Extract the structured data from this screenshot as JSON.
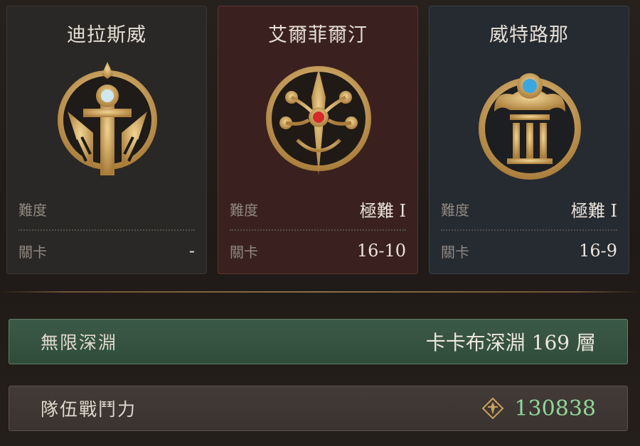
{
  "cards": [
    {
      "title": "迪拉斯威",
      "difficulty_label": "難度",
      "difficulty_value": "",
      "stage_label": "關卡",
      "stage_value": "-",
      "emblem": "dilasway-emblem"
    },
    {
      "title": "艾爾菲爾汀",
      "difficulty_label": "難度",
      "difficulty_value": "極難 I",
      "stage_label": "關卡",
      "stage_value": "16-10",
      "emblem": "elfelten-emblem"
    },
    {
      "title": "威特路那",
      "difficulty_label": "難度",
      "difficulty_value": "極難 I",
      "stage_label": "關卡",
      "stage_value": "16-9",
      "emblem": "wheatlena-emblem"
    }
  ],
  "abyss": {
    "label": "無限深淵",
    "value": "卡卡布深淵 169 層"
  },
  "power": {
    "label": "隊伍戰鬥力",
    "icon": "combat-power-icon",
    "value": "130838"
  },
  "colors": {
    "gold": "#c9a15b",
    "card_red": "#3a211f",
    "card_blue": "#262a31",
    "abyss_green": "#2f4c3a",
    "power_green": "#8ed89a"
  }
}
